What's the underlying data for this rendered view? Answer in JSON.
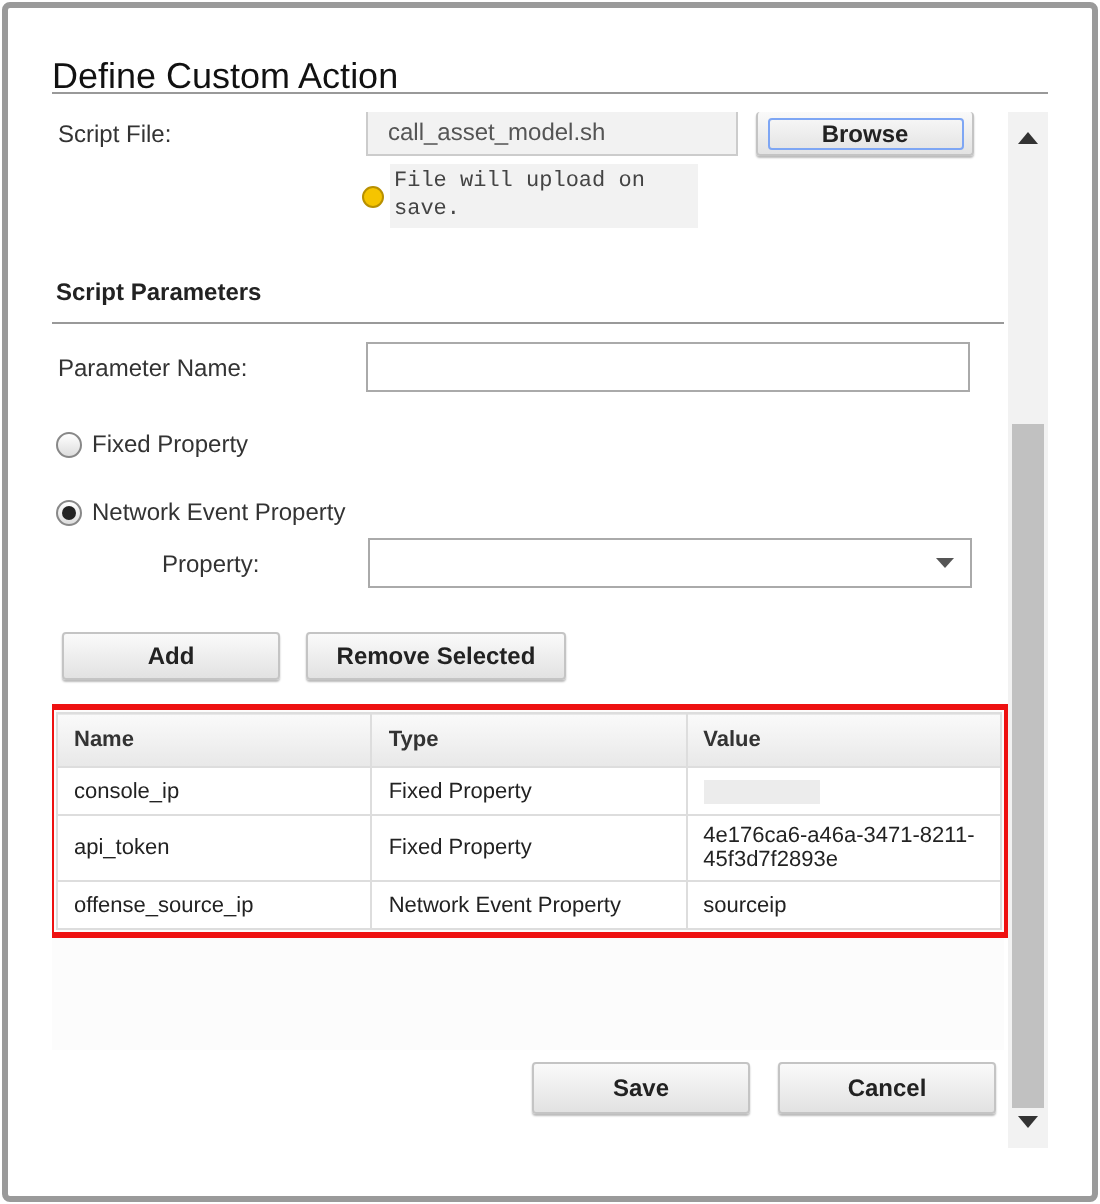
{
  "dialog": {
    "title": "Define Custom Action"
  },
  "script_file": {
    "label": "Script File:",
    "value": "call_asset_model.sh",
    "browse_button": "Browse",
    "note": "File will upload on save."
  },
  "section_title": "Script Parameters",
  "parameter_name": {
    "label": "Parameter Name:"
  },
  "property_types": [
    {
      "label": "Fixed Property",
      "selected": false
    },
    {
      "label": "Network Event Property",
      "selected": true
    }
  ],
  "property": {
    "label": "Property:"
  },
  "actions": [
    "Add",
    "Remove Selected"
  ],
  "table": {
    "columns": [
      "Name",
      "Type",
      "Value"
    ],
    "rows": [
      {
        "cells": [
          "console_ip",
          "Fixed Property",
          ""
        ],
        "redacted": true
      },
      {
        "cells": [
          "api_token",
          "Fixed Property",
          "4e176ca6-a46a-3471-8211-45f3d7f2893e"
        ],
        "redacted": false
      },
      {
        "cells": [
          "offense_source_ip",
          "Network Event Property",
          "sourceip"
        ],
        "redacted": false
      }
    ]
  },
  "footer_buttons": [
    "Save",
    "Cancel"
  ]
}
